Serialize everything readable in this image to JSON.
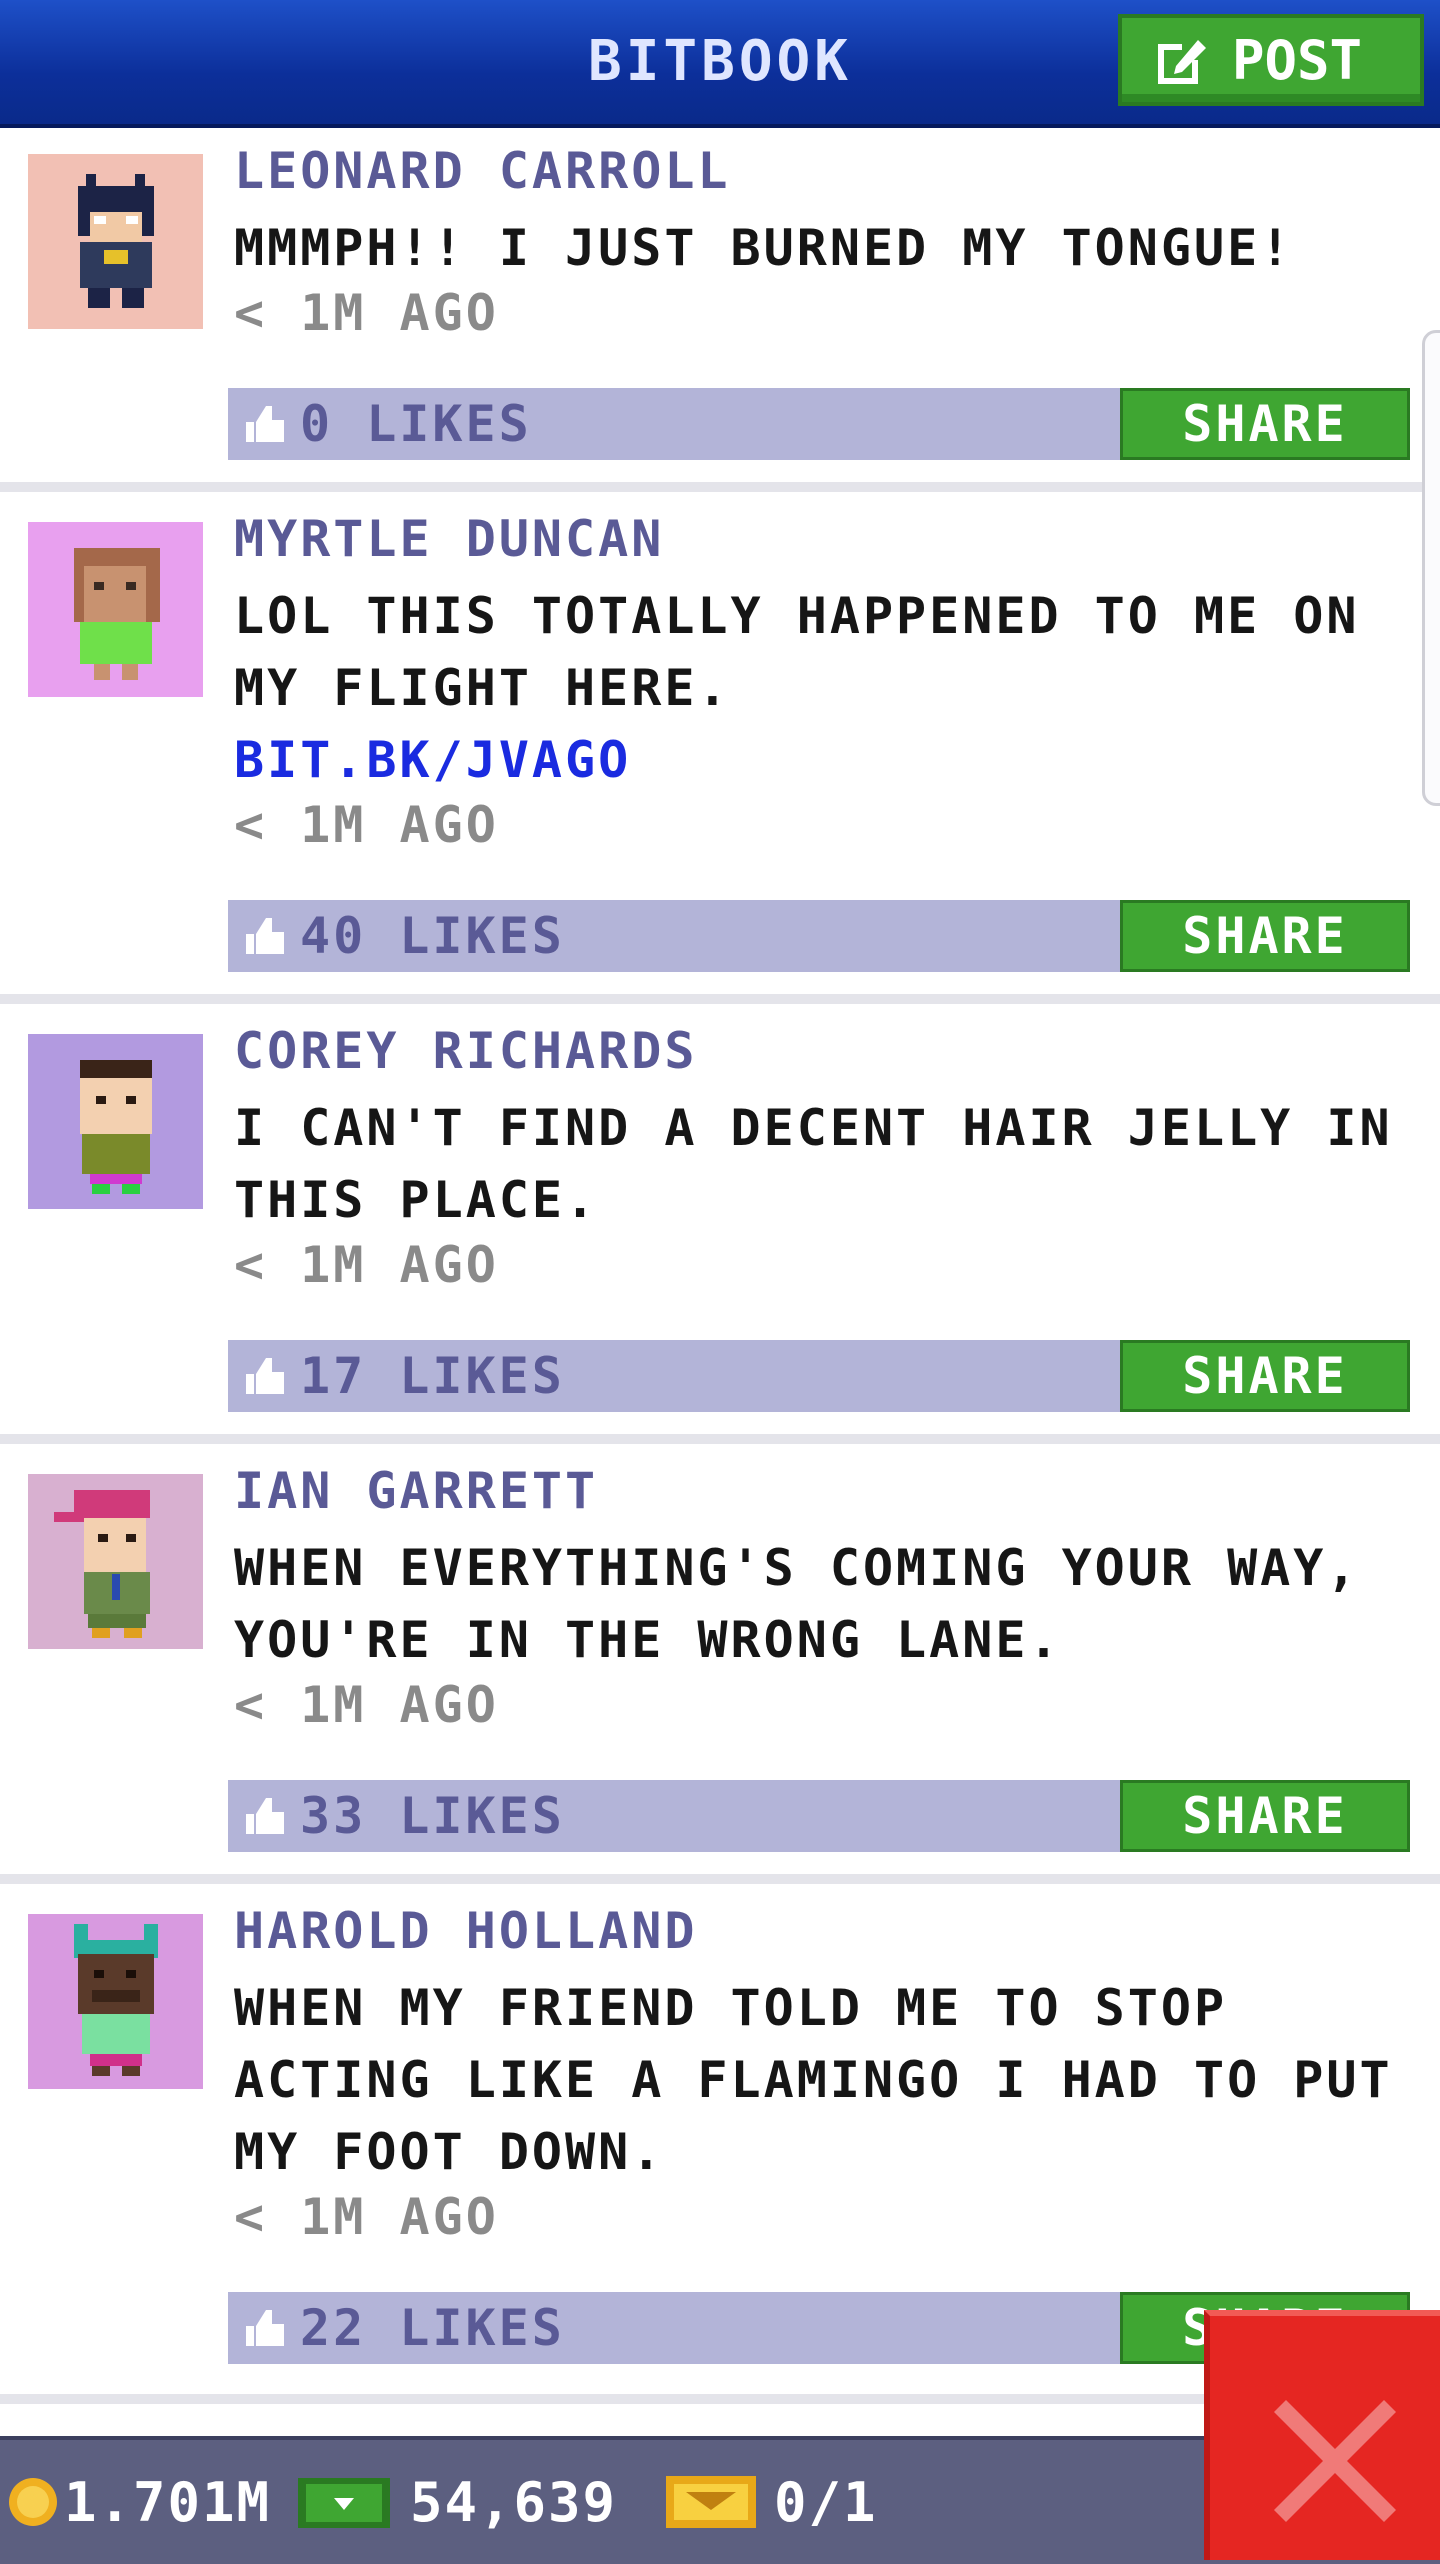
{
  "header": {
    "title": "BITBOOK",
    "post_label": "POST"
  },
  "posts": [
    {
      "name": "LEONARD CARROLL",
      "text": "MMMPH!! I JUST BURNED MY TONGUE!",
      "link": "",
      "time": "< 1M AGO",
      "likes": "0 LIKES",
      "share": "SHARE",
      "avatar_bg": "#f2c0b4"
    },
    {
      "name": "MYRTLE DUNCAN",
      "text": "LOL THIS TOTALLY HAPPENED TO ME ON MY FLIGHT HERE.",
      "link": "BIT.BK/JVAGO",
      "time": "< 1M AGO",
      "likes": "40 LIKES",
      "share": "SHARE",
      "avatar_bg": "#e8a0ef"
    },
    {
      "name": "COREY RICHARDS",
      "text": "I CAN'T FIND A DECENT HAIR JELLY IN THIS PLACE.",
      "link": "",
      "time": "< 1M AGO",
      "likes": "17 LIKES",
      "share": "SHARE",
      "avatar_bg": "#b29ae0"
    },
    {
      "name": "IAN GARRETT",
      "text": "WHEN EVERYTHING'S COMING YOUR WAY, YOU'RE IN THE WRONG LANE.",
      "link": "",
      "time": "< 1M AGO",
      "likes": "33 LIKES",
      "share": "SHARE",
      "avatar_bg": "#d8b0d0"
    },
    {
      "name": "HAROLD HOLLAND",
      "text": "WHEN MY FRIEND TOLD ME TO STOP ACTING LIKE A FLAMINGO I HAD TO PUT MY FOOT DOWN.",
      "link": "",
      "time": "< 1M AGO",
      "likes": "22 LIKES",
      "share": "SHARE",
      "avatar_bg": "#d89ae0"
    }
  ],
  "bottom_bar": {
    "coins": "1.701M",
    "bux": "54,639",
    "tickets": "0/1"
  },
  "icons": {
    "post": "edit-icon",
    "like": "thumbs-up-icon",
    "coin": "coin-icon",
    "bux": "bux-icon",
    "ticket": "ticket-icon",
    "close": "close-icon"
  }
}
